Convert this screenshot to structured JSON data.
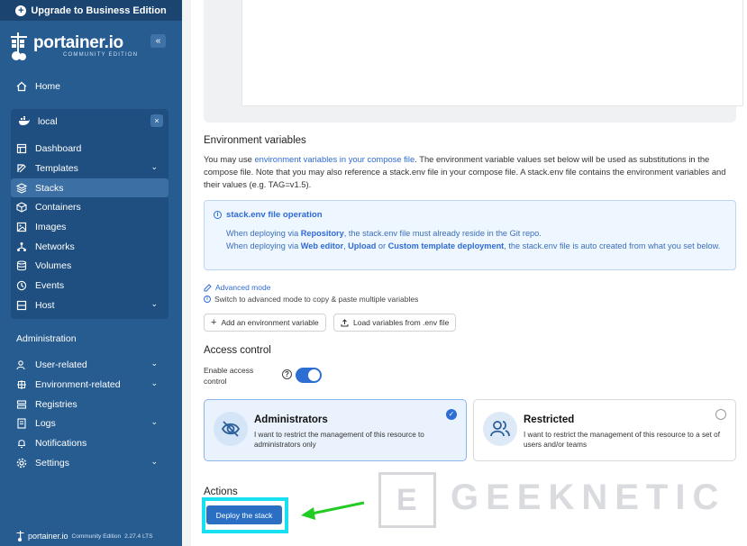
{
  "sidebar": {
    "upgrade_label": "Upgrade to Business Edition",
    "logo_text": "portainer.io",
    "logo_sub": "COMMUNITY EDITION",
    "home": "Home",
    "env_name": "local",
    "env_items": [
      {
        "label": "Dashboard",
        "icon": "dashboard-icon"
      },
      {
        "label": "Templates",
        "icon": "templates-icon",
        "expandable": true
      },
      {
        "label": "Stacks",
        "icon": "stacks-icon",
        "active": true
      },
      {
        "label": "Containers",
        "icon": "containers-icon"
      },
      {
        "label": "Images",
        "icon": "images-icon"
      },
      {
        "label": "Networks",
        "icon": "networks-icon"
      },
      {
        "label": "Volumes",
        "icon": "volumes-icon"
      },
      {
        "label": "Events",
        "icon": "events-icon"
      },
      {
        "label": "Host",
        "icon": "host-icon",
        "expandable": true
      }
    ],
    "admin_title": "Administration",
    "admin_items": [
      {
        "label": "User-related",
        "icon": "users-icon",
        "expandable": true
      },
      {
        "label": "Environment-related",
        "icon": "environment-icon",
        "expandable": true
      },
      {
        "label": "Registries",
        "icon": "registries-icon"
      },
      {
        "label": "Logs",
        "icon": "logs-icon",
        "expandable": true
      },
      {
        "label": "Notifications",
        "icon": "bell-icon"
      },
      {
        "label": "Settings",
        "icon": "gear-icon",
        "expandable": true
      }
    ],
    "footer_brand": "portainer.io",
    "footer_edition": "Community Edition",
    "footer_version": "2.27.4 LTS"
  },
  "main": {
    "env_vars_title": "Environment variables",
    "env_desc_1": "You may use ",
    "env_desc_link": "environment variables in your compose file",
    "env_desc_2": ". The environment variable values set below will be used as substitutions in the compose file. Note that you may also reference a stack.env file in your compose file. A stack.env file contains the environment variables and their values (e.g. TAG=v1.5).",
    "info_title": "stack.env file operation",
    "info_l1_a": "When deploying via ",
    "info_l1_b": "Repository",
    "info_l1_c": ", the stack.env file must already reside in the Git repo.",
    "info_l2_a": "When deploying via ",
    "info_l2_b": "Web editor",
    "info_l2_c": ", ",
    "info_l2_d": "Upload",
    "info_l2_e": " or ",
    "info_l2_f": "Custom template deployment",
    "info_l2_g": ", the stack.env file is auto created from what you set below.",
    "advanced_mode": "Advanced mode",
    "advanced_hint": "Switch to advanced mode to copy & paste multiple variables",
    "add_env_btn": "Add an environment variable",
    "load_env_btn": "Load variables from .env file",
    "access_title": "Access control",
    "access_toggle_label": "Enable access control",
    "access_enabled": true,
    "card_admin_title": "Administrators",
    "card_admin_desc": "I want to restrict the management of this resource to administrators only",
    "card_restr_title": "Restricted",
    "card_restr_desc": "I want to restrict the management of this resource to a set of users and/or teams",
    "actions_title": "Actions",
    "deploy_btn": "Deploy the stack"
  },
  "watermark": "GEEKNETIC",
  "colors": {
    "sidebar": "#275c91",
    "accent": "#2d6ed4",
    "highlight": "#18e0f0",
    "arrow": "#22cc22"
  }
}
